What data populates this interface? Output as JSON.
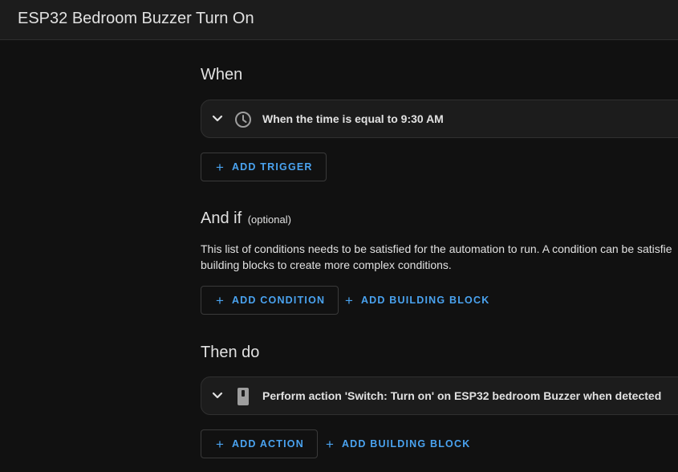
{
  "header": {
    "title": "ESP32 Bedroom Buzzer Turn On"
  },
  "when": {
    "heading": "When",
    "trigger": {
      "icon": "clock-icon",
      "text": "When the time is equal to 9:30 AM"
    },
    "add_trigger_label": "ADD TRIGGER"
  },
  "and_if": {
    "heading": "And if",
    "optional_label": "(optional)",
    "description_line1": "This list of conditions needs to be satisfied for the automation to run. A condition can be satisfie",
    "description_line2": "building blocks to create more complex conditions.",
    "add_condition_label": "ADD CONDITION",
    "add_building_block_label": "ADD BUILDING BLOCK"
  },
  "then_do": {
    "heading": "Then do",
    "action": {
      "icon": "switch-icon",
      "text": "Perform action 'Switch: Turn on' on ESP32 bedroom Buzzer when detected"
    },
    "add_action_label": "ADD ACTION",
    "add_building_block_label": "ADD BUILDING BLOCK"
  },
  "colors": {
    "accent": "#4aa3f0",
    "background": "#111111",
    "card": "#1c1c1c"
  }
}
